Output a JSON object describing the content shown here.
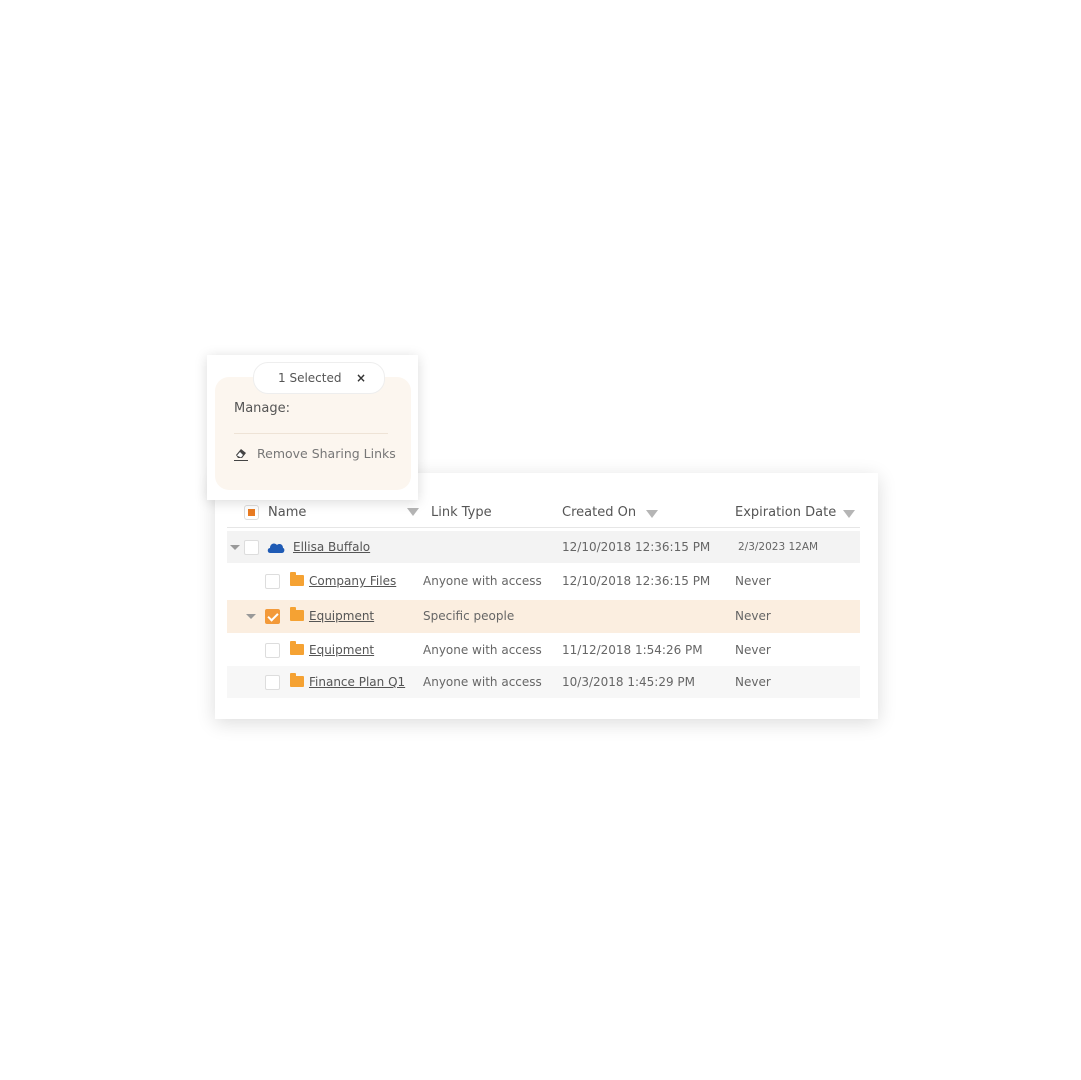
{
  "popup": {
    "selected_label": "1 Selected",
    "close_icon": "close-icon",
    "manage_label": "Manage:",
    "action_label": "Remove Sharing Links",
    "action_icon": "eraser-icon"
  },
  "table": {
    "columns": [
      "Name",
      "Link Type",
      "Created On",
      "Expiration Date"
    ],
    "rows": [
      {
        "name": "Ellisa Buffalo",
        "icon": "onedrive-cloud-icon",
        "link_type": "",
        "created_on": "12/10/2018 12:36:15 PM",
        "expiration": "2/3/2023 12AM",
        "checked": false,
        "expandable": true
      },
      {
        "name": "Company Files",
        "icon": "folder-icon",
        "link_type": "Anyone with access",
        "created_on": "12/10/2018 12:36:15 PM",
        "expiration": "Never",
        "checked": false,
        "expandable": false
      },
      {
        "name": "Equipment",
        "icon": "folder-icon",
        "link_type": "Specific people",
        "created_on": "",
        "expiration": "Never",
        "checked": true,
        "expandable": true
      },
      {
        "name": "Equipment",
        "icon": "folder-icon",
        "link_type": "Anyone with access",
        "created_on": "11/12/2018 1:54:26 PM",
        "expiration": "Never",
        "checked": false,
        "expandable": false
      },
      {
        "name": "Finance Plan Q1",
        "icon": "folder-icon",
        "link_type": "Anyone with access",
        "created_on": "10/3/2018 1:45:29 PM",
        "expiration": "Never",
        "checked": false,
        "expandable": false
      }
    ]
  },
  "colors": {
    "accent": "#f39a3a",
    "selected_row": "#fbeee0",
    "cloud": "#1f5bb5"
  }
}
